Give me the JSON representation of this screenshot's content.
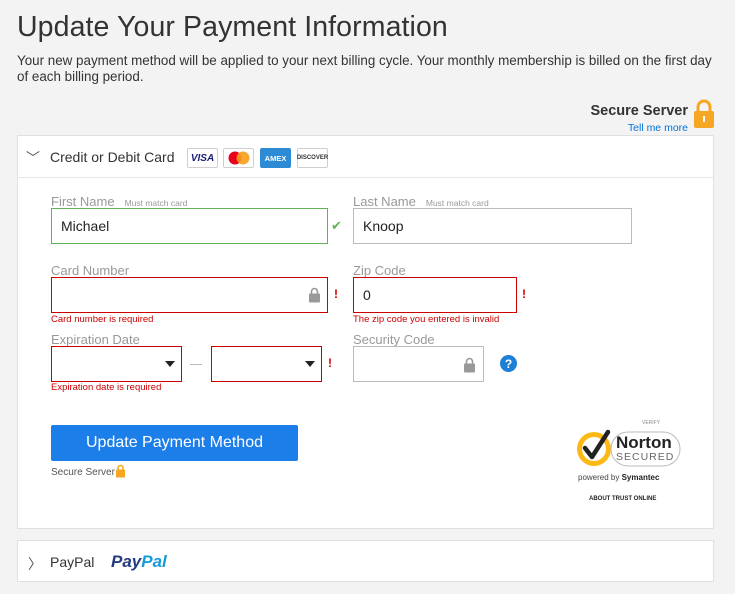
{
  "page": {
    "title": "Update Your Payment Information",
    "intro": "Your new payment method will be applied to your next billing cycle. Your monthly membership is billed on the first day of each billing period."
  },
  "secure_header": {
    "label": "Secure Server",
    "link": "Tell me more"
  },
  "card_panel": {
    "label": "Credit or Debit Card",
    "logos": [
      "VISA",
      "MasterCard",
      "AMEX",
      "DISCOVER"
    ]
  },
  "form": {
    "first_name": {
      "label": "First Name",
      "hint": "Must match card",
      "value": "Michael"
    },
    "last_name": {
      "label": "Last Name",
      "hint": "Must match card",
      "value": "Knoop"
    },
    "card_number": {
      "label": "Card Number",
      "value": "",
      "error": "Card number is required"
    },
    "zip_code": {
      "label": "Zip Code",
      "value": "0",
      "error": "The zip code you entered is invalid"
    },
    "expiration": {
      "label": "Expiration Date",
      "month": "",
      "year": "",
      "error": "Expiration date is required"
    },
    "security_code": {
      "label": "Security Code",
      "value": ""
    },
    "error_mark": "!",
    "help_mark": "?"
  },
  "submit": {
    "label": "Update Payment Method",
    "secure_note": "Secure Server"
  },
  "norton": {
    "verify": "VERIFY",
    "name": "Norton",
    "secured": "SECURED",
    "powered_prefix": "powered by",
    "powered_brand": "Symantec",
    "about": "ABOUT TRUST ONLINE"
  },
  "paypal_panel": {
    "label": "PayPal",
    "logo_a": "Pay",
    "logo_b": "Pal"
  },
  "colors": {
    "accent": "#1c7ee8",
    "error": "#cc0000",
    "valid": "#5fb354",
    "lock": "#f5a623"
  }
}
